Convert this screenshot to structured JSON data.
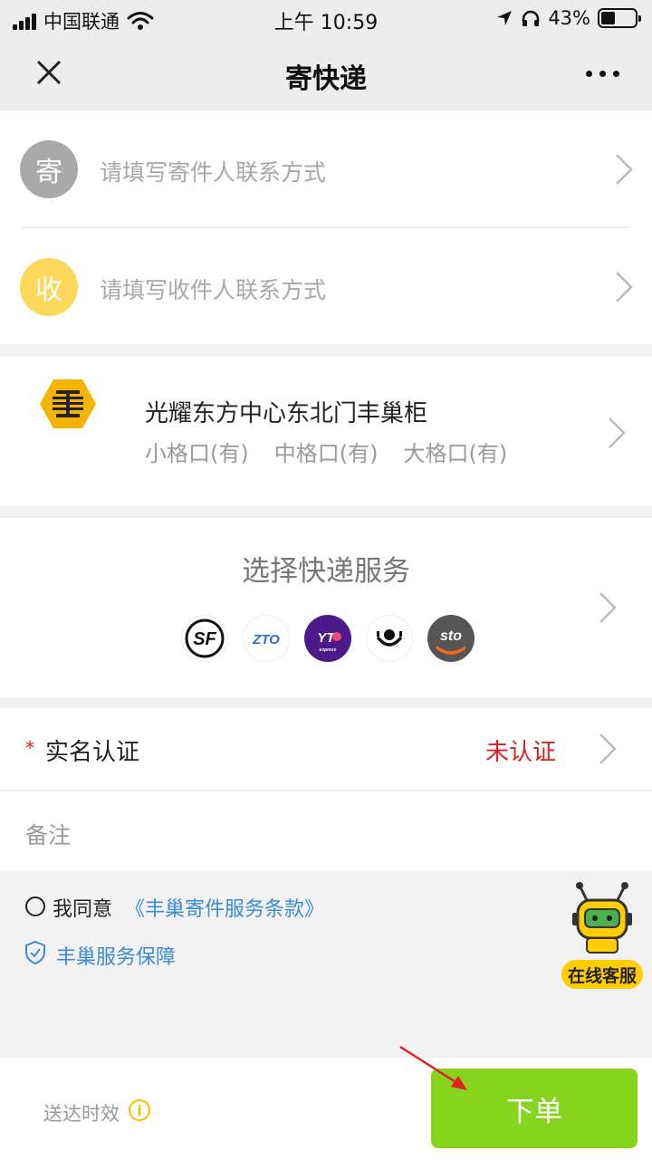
{
  "status_bar": {
    "carrier": "中国联通",
    "time": "上午 10:59",
    "battery": "43%",
    "battery_level": 0.43,
    "icons": [
      "signal-icon",
      "wifi-icon",
      "location-icon",
      "headphones-icon",
      "battery-icon"
    ]
  },
  "nav": {
    "title": "寄快递",
    "close_icon": "close-icon",
    "more_icon": "more-icon"
  },
  "sender": {
    "badge": "寄",
    "placeholder": "请填写寄件人联系方式",
    "badge_color": "#a9a9a9"
  },
  "receiver": {
    "badge": "收",
    "placeholder": "请填写收件人联系方式",
    "badge_color": "#fdd85a"
  },
  "locker": {
    "name": "光耀东方中心东北门丰巢柜",
    "slots": [
      "小格口(有)",
      "中格口(有)",
      "大格口(有)"
    ],
    "icon": "locker-hexagon-icon",
    "icon_color": "#f5b400"
  },
  "express": {
    "title": "选择快递服务",
    "logos": [
      {
        "name": "SF",
        "icon": "sf-logo"
      },
      {
        "name": "ZTO",
        "icon": "zto-logo"
      },
      {
        "name": "YTO",
        "icon": "yto-logo"
      },
      {
        "name": "",
        "icon": "yunda-logo"
      },
      {
        "name": "sto",
        "icon": "sto-logo"
      }
    ]
  },
  "realname": {
    "required_mark": "*",
    "label": "实名认证",
    "status": "未认证",
    "status_color": "#e02020"
  },
  "remark": {
    "label": "备注"
  },
  "agreement": {
    "prefix": "我同意",
    "link": "《丰巢寄件服务条款》",
    "guarantee": "丰巢服务保障",
    "link_color": "#3c8ad6"
  },
  "customer_service": {
    "label": "在线客服",
    "icon": "robot-icon"
  },
  "footer": {
    "eta_label": "送达时效",
    "info_icon": "info-icon",
    "submit_label": "下单",
    "submit_color": "#86d41e"
  }
}
